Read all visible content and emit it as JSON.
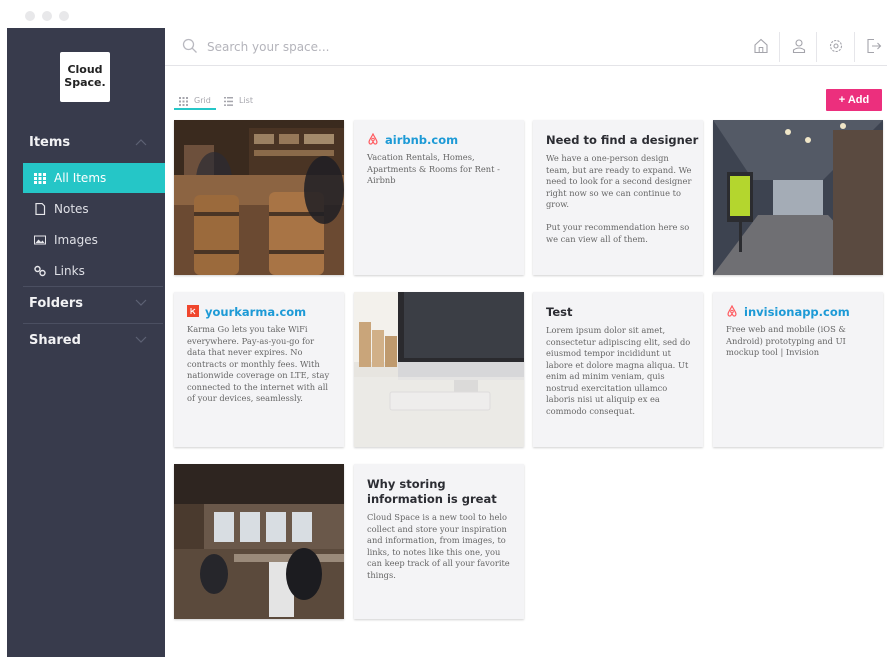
{
  "app": {
    "logo_line1": "Cloud",
    "logo_line2": "Space."
  },
  "search": {
    "placeholder": "Search your space..."
  },
  "sidebar": {
    "items_section": "Items",
    "folders_section": "Folders",
    "shared_section": "Shared",
    "items": [
      {
        "label": "All Items",
        "icon": "grid-icon",
        "active": true
      },
      {
        "label": "Notes",
        "icon": "note-icon"
      },
      {
        "label": "Images",
        "icon": "image-icon"
      },
      {
        "label": "Links",
        "icon": "link-icon"
      }
    ]
  },
  "toolbar": {
    "grid_label": "Grid",
    "list_label": "List",
    "add_label": "+ Add",
    "icons": [
      "home-icon",
      "user-icon",
      "gear-icon",
      "logout-icon"
    ]
  },
  "colors": {
    "sidebar": "#383b4c",
    "accent": "#25c6c7",
    "add": "#ec2f7d",
    "link": "#1d9ad6",
    "airbnb": "#ff5a5f",
    "yourkarma": "#f0462d"
  },
  "cards": [
    {
      "type": "image",
      "image": "bar-photo"
    },
    {
      "type": "link",
      "icon": "airbnb-icon",
      "title": "airbnb.com",
      "body": "Vacation Rentals, Homes, Apartments & Rooms for Rent - Airbnb"
    },
    {
      "type": "note",
      "title": "Need to find a designer",
      "body": "We have a one-person design team, but are ready to expand. We need to look for a second designer right now so we can continue to grow.\n\nPut your recommendation here so we can view all of them."
    },
    {
      "type": "image",
      "image": "office-hallway-photo"
    },
    {
      "type": "link",
      "icon": "yourkarma-icon",
      "title": "yourkarma.com",
      "body": "Karma Go lets you take WiFi everywhere. Pay-as-you-go for data that never expires. No contracts or monthly fees. With nationwide coverage on LTE, stay connected to the internet with all of your devices, seamlessly."
    },
    {
      "type": "image",
      "image": "imac-desk-photo"
    },
    {
      "type": "note",
      "title": "Test",
      "body": "Lorem ipsum dolor sit amet, consectetur adipiscing elit, sed do eiusmod tempor incididunt ut labore et dolore magna aliqua. Ut enim ad minim veniam, quis nostrud exercitation ullamco laboris nisi ut aliquip ex ea commodo consequat."
    },
    {
      "type": "link",
      "icon": "airbnb-icon",
      "title": "invisionapp.com",
      "body": "Free web and mobile (iOS & Android) prototyping and UI mockup tool | Invision"
    },
    {
      "type": "image",
      "image": "open-office-photo"
    },
    {
      "type": "note",
      "title": "Why storing information is great",
      "body": "Cloud Space is a new tool to helo collect and store your inspiration and information, from images, to links, to notes like this one, you can keep track of all your favorite things."
    }
  ]
}
